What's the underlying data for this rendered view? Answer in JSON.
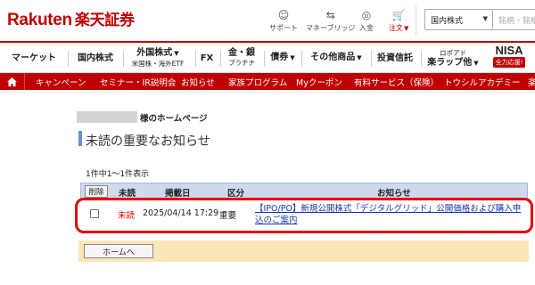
{
  "header": {
    "logo_en": "Rakuten",
    "logo_jp": "楽天証券",
    "icons": [
      {
        "label": "サポート",
        "icon": "support-icon",
        "glyph": "☺"
      },
      {
        "label": "マネーブリッジ",
        "icon": "money-bridge-icon",
        "glyph": "⇆"
      },
      {
        "label": "入金",
        "icon": "deposit-icon",
        "glyph": "◎"
      },
      {
        "label": "注文",
        "icon": "cart-icon",
        "glyph": "🛒"
      }
    ],
    "search_select": "国内株式",
    "search_placeholder": "銘柄・銘柄コード"
  },
  "nav": {
    "items": [
      {
        "label": "マーケット"
      },
      {
        "label": "国内株式"
      },
      {
        "label": "外国株式",
        "sub": "米国株・海外ETF"
      },
      {
        "label": "FX"
      },
      {
        "label": "金・銀",
        "sub": "プラチナ"
      },
      {
        "label": "債券"
      },
      {
        "label": "その他商品"
      },
      {
        "label": "投資信託"
      },
      {
        "label": "ロボアド",
        "sub": "楽ラップ他"
      }
    ],
    "nisa": "NISA",
    "nisa_badge": "全力応援!"
  },
  "redbar": {
    "items": [
      "キャンペーン",
      "セミナー・IR説明会",
      "お知らせ",
      "家族プログラム",
      "Myクーポン",
      "有料サービス（保険）",
      "トウシルアカデミー",
      "楽"
    ]
  },
  "main": {
    "username_suffix": "様のホームページ",
    "title": "未読の重要なお知らせ",
    "count": "1件中1～1件表示",
    "table": {
      "delete_label": "削除",
      "headers": [
        "未読",
        "掲載日",
        "区分",
        "お知らせ"
      ],
      "rows": [
        {
          "status": "未読",
          "date": "2025/04/14 17:29",
          "category": "重要",
          "notice": "【IPO/PO】新規公開株式「デジタルグリッド」公開価格および購入申込のご案内"
        }
      ]
    },
    "home_button": "ホームへ"
  },
  "colors": {
    "brand_red": "#bf0000",
    "table_header": "#cfd9ee",
    "footer_bar": "#fbe6b8",
    "highlight": "#e60000",
    "link": "#1a37a8"
  }
}
